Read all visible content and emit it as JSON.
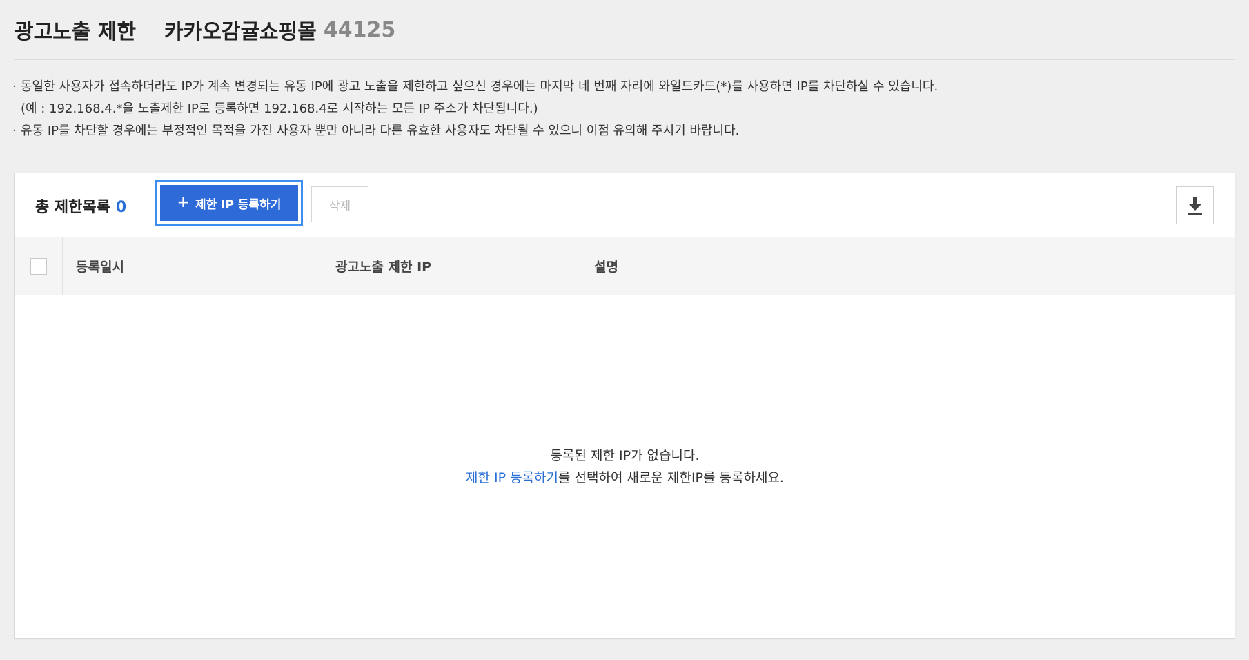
{
  "header": {
    "title": "광고노출 제한",
    "store_name": "카카오감귤쇼핑몰",
    "store_id": "44125"
  },
  "notice": {
    "bullet": "·",
    "line1": "동일한 사용자가 접속하더라도 IP가 계속 변경되는 유동 IP에 광고 노출을 제한하고 싶으신 경우에는 마지막 네 번째 자리에 와일드카드(*)를 사용하면 IP를 차단하실 수 있습니다.",
    "line2": "(예 : 192.168.4.*을 노출제한 IP로 등록하면 192.168.4로 시작하는 모든 IP 주소가 차단됩니다.)",
    "line3": "유동 IP를 차단할 경우에는 부정적인 목적을 가진 사용자 뿐만 아니라 다른 유효한 사용자도 차단될 수 있으니 이점 유의해 주시기 바랍니다."
  },
  "toolbar": {
    "total_label": "총 제한목록",
    "total_count": "0",
    "register_icon": "+",
    "register_label": "제한 IP 등록하기",
    "delete_label": "삭제",
    "download_icon": "download-icon"
  },
  "table": {
    "columns": [
      "등록일시",
      "광고노출 제한 IP",
      "설명"
    ],
    "rows": []
  },
  "empty": {
    "message": "등록된 제한 IP가 없습니다.",
    "link": "제한 IP 등록하기",
    "message_suffix": "를 선택하여 새로운 제한IP를 등록하세요."
  },
  "colors": {
    "primary": "#2f6ad9",
    "focus_outline": "#3d8ef0",
    "accent_text": "#2a6fd6",
    "background": "#efefef"
  }
}
